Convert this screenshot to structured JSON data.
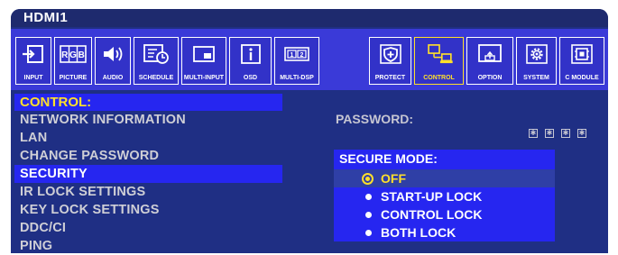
{
  "window": {
    "title": "HDMI1"
  },
  "toolbar": {
    "items": [
      {
        "label": "INPUT",
        "icon": "input-arrow-icon"
      },
      {
        "label": "PICTURE",
        "icon": "rgb-icon"
      },
      {
        "label": "AUDIO",
        "icon": "speaker-icon"
      },
      {
        "label": "SCHEDULE",
        "icon": "schedule-clock-icon"
      },
      {
        "label": "MULTI-INPUT",
        "icon": "multi-input-icon"
      },
      {
        "label": "OSD",
        "icon": "info-icon"
      },
      {
        "label": "MULTI-DSP",
        "icon": "multi-display-icon"
      },
      {
        "label": "PROTECT",
        "icon": "shield-icon"
      },
      {
        "label": "CONTROL",
        "icon": "computer-control-icon",
        "active": true
      },
      {
        "label": "OPTION",
        "icon": "option-monitor-icon"
      },
      {
        "label": "SYSTEM",
        "icon": "gear-icon"
      },
      {
        "label": "C MODULE",
        "icon": "compute-module-icon"
      }
    ]
  },
  "menu": {
    "header": "CONTROL:",
    "items": [
      "NETWORK INFORMATION",
      "LAN",
      "CHANGE PASSWORD",
      "SECURITY",
      "IR LOCK SETTINGS",
      "KEY LOCK SETTINGS",
      "DDC/CI",
      "PING"
    ],
    "selected_index": 3
  },
  "password": {
    "label": "PASSWORD:",
    "masked_digits": [
      "✱",
      "✱",
      "✱",
      "✱"
    ]
  },
  "secure_mode": {
    "title": "SECURE MODE:",
    "options": [
      "OFF",
      "START-UP LOCK",
      "CONTROL LOCK",
      "BOTH LOCK"
    ],
    "selected_index": 0
  },
  "colors": {
    "osd_background": "#1f2f84",
    "highlight": "#2626f0",
    "active_accent": "#ffe02a",
    "toolbar_background": "#3a3ad8"
  }
}
